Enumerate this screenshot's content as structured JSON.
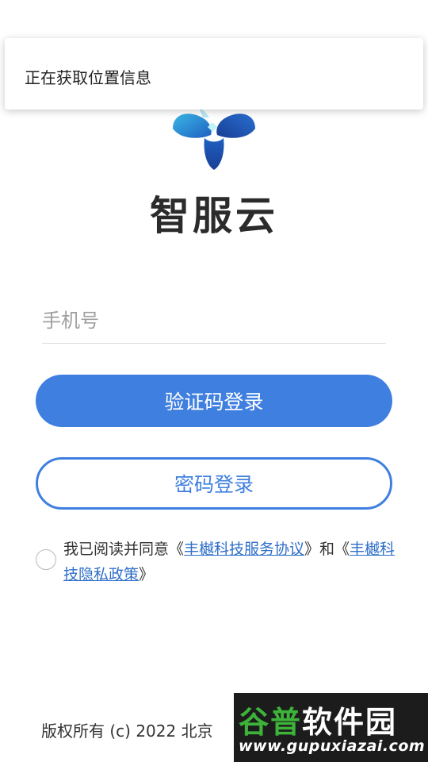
{
  "toast": {
    "text": "正在获取位置信息"
  },
  "brand": {
    "name": "智服云"
  },
  "login": {
    "phone_placeholder": "手机号",
    "sms_login_label": "验证码登录",
    "password_login_label": "密码登录"
  },
  "agreement": {
    "prefix": "我已阅读并同意《",
    "service_link": "丰樾科技服务协议",
    "middle": "》和《",
    "privacy_link": "丰樾科技隐私政策",
    "suffix": "》",
    "checked": false
  },
  "footer": {
    "copyright": "版权所有 (c) 2022 北京"
  },
  "watermark": {
    "title_a": "谷普",
    "title_b": "软件园",
    "url": "www.gupuxiazai.com"
  },
  "colors": {
    "primary": "#3f7fe0",
    "link": "#2f6fc8",
    "logo_dark": "#1f4fa8",
    "logo_light": "#3ab8e6"
  }
}
